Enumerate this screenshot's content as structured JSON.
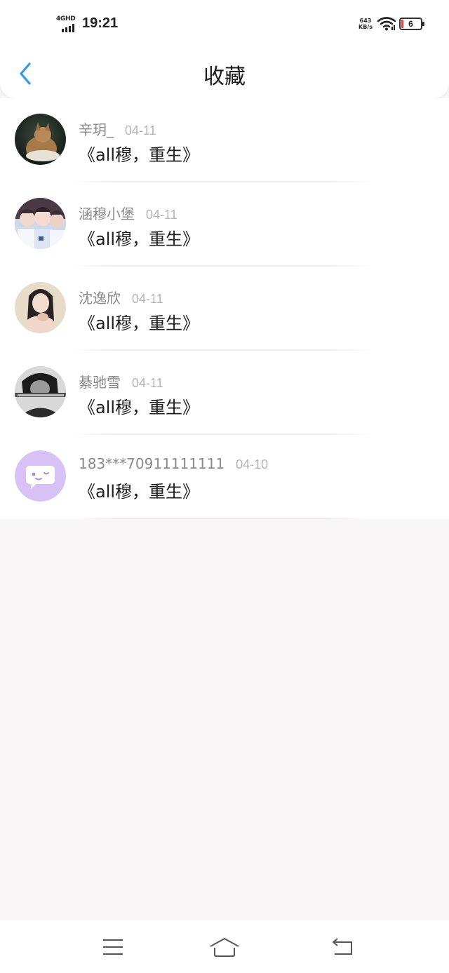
{
  "status_bar": {
    "network_label": "4GHD",
    "time": "19:21",
    "speed_value": "643",
    "speed_unit": "KB/s",
    "battery_level": "6",
    "battery_color": "#e0443e"
  },
  "header": {
    "title": "收藏",
    "back_icon": "chevron-left-icon",
    "accent_color": "#2f9be9"
  },
  "favorites": [
    {
      "username": "辛玥_",
      "date": "04-11",
      "title": "《all穆，重生》",
      "avatar": "dog-photo"
    },
    {
      "username": "涵穆小堡",
      "date": "04-11",
      "title": "《all穆，重生》",
      "avatar": "group-photo"
    },
    {
      "username": "沈逸欣",
      "date": "04-11",
      "title": "《all穆，重生》",
      "avatar": "girl-photo"
    },
    {
      "username": "綦驰雪",
      "date": "04-11",
      "title": "《all穆，重生》",
      "avatar": "bw-photo"
    },
    {
      "username": "183***70911111111",
      "date": "04-10",
      "title": "《all穆，重生》",
      "avatar": "default-chat-avatar"
    }
  ],
  "nav_bar": {
    "buttons": [
      "menu-icon",
      "home-icon",
      "back-icon"
    ]
  }
}
